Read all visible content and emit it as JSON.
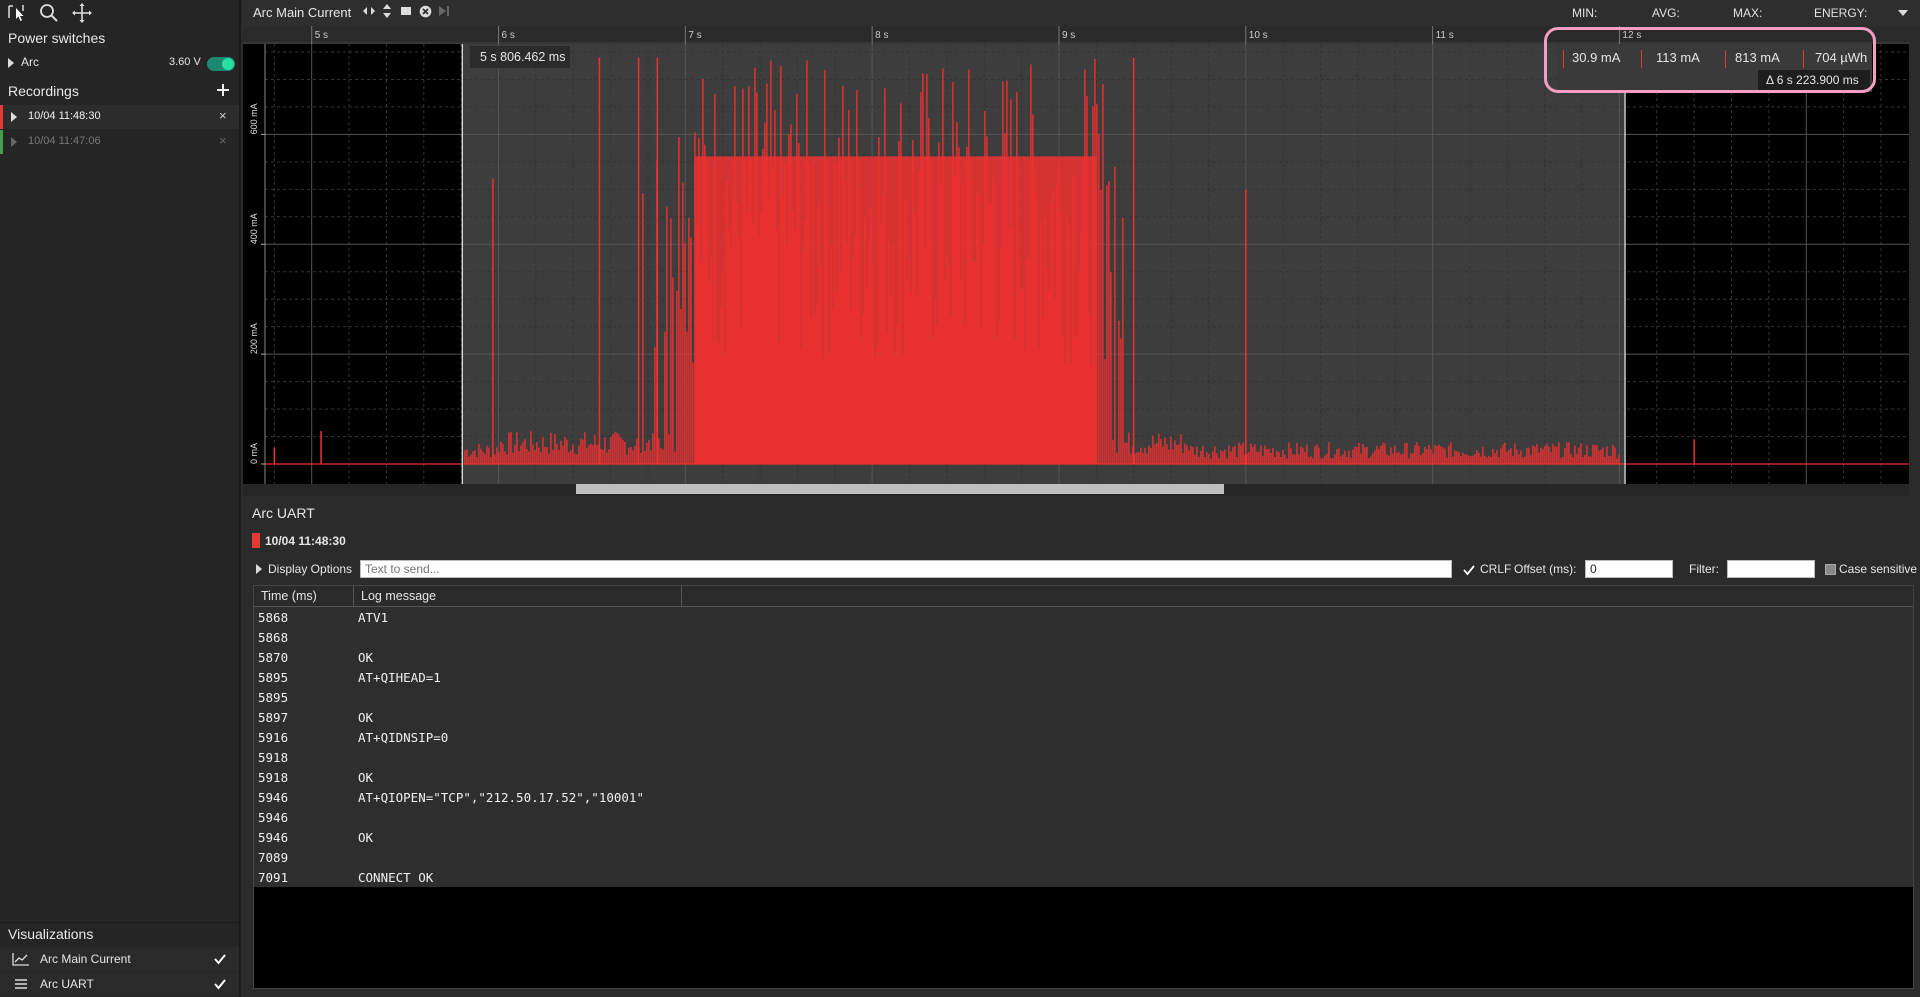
{
  "toolbar": {
    "icons": [
      "pointer-select-icon",
      "zoom-icon",
      "pan-icon"
    ]
  },
  "sidebar": {
    "power_switches_title": "Power switches",
    "power_item": {
      "label": "Arc",
      "voltage": "3.60 V",
      "enabled": true
    },
    "recordings_title": "Recordings",
    "recordings": [
      {
        "label": "10/04 11:48:30",
        "color": "#e53935",
        "active": true
      },
      {
        "label": "10/04 11:47:06",
        "color": "#43a047",
        "active": false
      }
    ],
    "visualizations_title": "Visualizations",
    "visualizations": [
      {
        "label": "Arc Main Current",
        "icon": "line-chart-icon",
        "checked": true
      },
      {
        "label": "Arc UART",
        "icon": "list-icon",
        "checked": true
      }
    ]
  },
  "chart_header": {
    "title": "Arc Main Current",
    "stats_labels": {
      "min": "MIN:",
      "avg": "AVG:",
      "max": "MAX:",
      "energy": "ENERGY:"
    },
    "stats_values": {
      "min": "30.9 mA",
      "avg": "113 mA",
      "max": "813 mA",
      "energy": "704 µWh"
    },
    "delta": "Δ 6 s 223.900 ms",
    "cursor_time": "5 s 806.462 ms",
    "highlight_color": "#f29fc2"
  },
  "chart_data": {
    "type": "line",
    "title": "Arc Main Current",
    "x_ticks": [
      "5 s",
      "6 s",
      "7 s",
      "8 s",
      "9 s",
      "10 s",
      "11 s",
      "12 s"
    ],
    "y_ticks": [
      "0 mA",
      "200 mA",
      "400 mA",
      "600 mA"
    ],
    "xlim": [
      4.75,
      13.55
    ],
    "ylim": [
      0,
      750
    ],
    "series": [
      {
        "color": "#f03030",
        "baseline_mA": 0,
        "selection": [
          5.806,
          12.03
        ]
      }
    ],
    "grid": true
  },
  "uart": {
    "title": "Arc UART",
    "recording_label": "10/04 11:48:30",
    "recording_color": "#e53935",
    "display_options_label": "Display Options",
    "send_placeholder": "Text to send...",
    "crlf_label": "CRLF",
    "offset_label": "Offset (ms):",
    "offset_value": "0",
    "filter_label": "Filter:",
    "filter_value": "",
    "case_sensitive_label": "Case sensitive",
    "columns": [
      "Time (ms)",
      "Log message"
    ],
    "rows": [
      {
        "time": "5868",
        "msg": "ATV1"
      },
      {
        "time": "5868",
        "msg": ""
      },
      {
        "time": "5870",
        "msg": "OK"
      },
      {
        "time": "5895",
        "msg": "AT+QIHEAD=1"
      },
      {
        "time": "5895",
        "msg": ""
      },
      {
        "time": "5897",
        "msg": "OK"
      },
      {
        "time": "5916",
        "msg": "AT+QIDNSIP=0"
      },
      {
        "time": "5918",
        "msg": ""
      },
      {
        "time": "5918",
        "msg": "OK"
      },
      {
        "time": "5946",
        "msg": "AT+QIOPEN=\"TCP\",\"212.50.17.52\",\"10001\""
      },
      {
        "time": "5946",
        "msg": ""
      },
      {
        "time": "5946",
        "msg": "OK"
      },
      {
        "time": "7089",
        "msg": ""
      },
      {
        "time": "7091",
        "msg": "CONNECT OK"
      }
    ]
  }
}
